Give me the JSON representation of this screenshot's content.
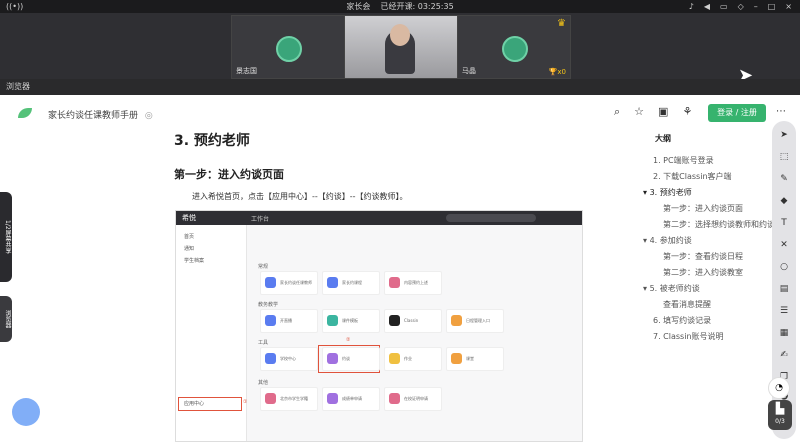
{
  "topbar": {
    "meeting_name": "家长会",
    "status": "已经开课: 03:25:35",
    "left_icon": "broadcast-icon",
    "right_icons": [
      "mic-icon",
      "volume-icon",
      "camera-icon",
      "chat-icon",
      "minimize-icon",
      "restore-icon",
      "close-icon"
    ]
  },
  "video": {
    "tiles": [
      {
        "name": "景志国",
        "kind": "avatar"
      },
      {
        "name": "",
        "kind": "camera"
      },
      {
        "name": "马晶",
        "kind": "avatar",
        "trophy": "x0"
      }
    ]
  },
  "browser": {
    "title": "浏览器"
  },
  "doc": {
    "title": "家长约谈任课教师手册",
    "login_label": "登录 / 注册",
    "h1": "3. 预约老师",
    "step": "第一步：进入约谈页面",
    "paragraph": "进入希悦首页，点击【应用中心】--【约谈】--【约谈教师】。"
  },
  "screenshot": {
    "brand": "希悦",
    "header_text": "工作台",
    "search_placeholder": "搜索",
    "side_items": [
      "首页",
      "通知",
      "学生档案",
      "应用中心"
    ],
    "sections": [
      "常规",
      "教务教学",
      "工具",
      "其他"
    ],
    "cards": [
      "家长约谈任课教师",
      "家长约课程",
      "内容预约上述",
      "开直播",
      "课件模板",
      "Classin",
      "日程管理入口",
      "学校中心",
      "约谈",
      "作业",
      "课堂",
      "北京市学生学籍",
      "成绩单申请",
      "在校证明申请"
    ],
    "marker_1": "①",
    "marker_2": "②"
  },
  "outline": {
    "title": "大纲",
    "items": [
      {
        "text": "1. PC端账号登录",
        "level": 1
      },
      {
        "text": "2. 下载Classin客户端",
        "level": 1
      },
      {
        "text": "3. 预约老师",
        "level": 1,
        "expanded": true
      },
      {
        "text": "第一步：进入约谈页面",
        "level": 2
      },
      {
        "text": "第二步：选择想约谈教师和约谈...",
        "level": 2
      },
      {
        "text": "4. 参加约谈",
        "level": 1,
        "expanded": true
      },
      {
        "text": "第一步：查看约谈日程",
        "level": 2
      },
      {
        "text": "第二步：进入约谈教室",
        "level": 2
      },
      {
        "text": "5. 被老师约谈",
        "level": 1,
        "expanded": true
      },
      {
        "text": "查看消息提醒",
        "level": 2
      },
      {
        "text": "6. 填写约谈记录",
        "level": 1
      },
      {
        "text": "7. Classin账号说明",
        "level": 1
      }
    ]
  },
  "left_tabs": [
    "1/2屏幕共享",
    "浏览器"
  ],
  "pager": "0/3",
  "colors": {
    "accent_green": "#36b36e",
    "marker_red": "#e0533c"
  }
}
